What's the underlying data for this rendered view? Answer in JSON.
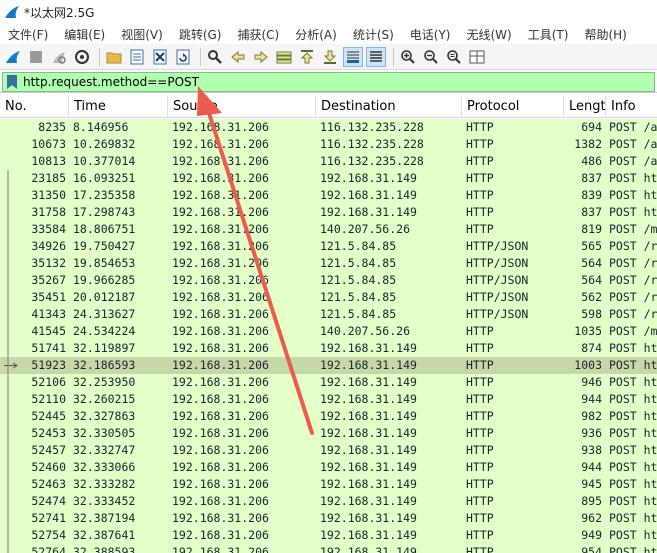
{
  "window": {
    "title": "*以太网2.5G"
  },
  "menu": [
    "文件(F)",
    "编辑(E)",
    "视图(V)",
    "跳转(G)",
    "捕获(C)",
    "分析(A)",
    "统计(S)",
    "电话(Y)",
    "无线(W)",
    "工具(T)",
    "帮助(H)"
  ],
  "filter": {
    "value": "http.request.method==POST"
  },
  "columns": [
    "No.",
    "Time",
    "Source",
    "Destination",
    "Protocol",
    "Lengt",
    "Info"
  ],
  "packets": [
    {
      "no": "8235",
      "time": "8.146956",
      "src": "192.168.31.206",
      "dst": "116.132.235.228",
      "proto": "HTTP",
      "len": "694",
      "info": "POST /a"
    },
    {
      "no": "10673",
      "time": "10.269832",
      "src": "192.168.31.206",
      "dst": "116.132.235.228",
      "proto": "HTTP",
      "len": "1382",
      "info": "POST /a"
    },
    {
      "no": "10813",
      "time": "10.377014",
      "src": "192.168.31.206",
      "dst": "116.132.235.228",
      "proto": "HTTP",
      "len": "486",
      "info": "POST /a"
    },
    {
      "no": "23185",
      "time": "16.093251",
      "src": "192.168.31.206",
      "dst": "192.168.31.149",
      "proto": "HTTP",
      "len": "837",
      "info": "POST ht"
    },
    {
      "no": "31350",
      "time": "17.235358",
      "src": "192.168.31.206",
      "dst": "192.168.31.149",
      "proto": "HTTP",
      "len": "839",
      "info": "POST ht"
    },
    {
      "no": "31758",
      "time": "17.298743",
      "src": "192.168.31.206",
      "dst": "192.168.31.149",
      "proto": "HTTP",
      "len": "837",
      "info": "POST ht"
    },
    {
      "no": "33584",
      "time": "18.806751",
      "src": "192.168.31.206",
      "dst": "140.207.56.26",
      "proto": "HTTP",
      "len": "819",
      "info": "POST /m"
    },
    {
      "no": "34926",
      "time": "19.750427",
      "src": "192.168.31.206",
      "dst": "121.5.84.85",
      "proto": "HTTP/JSON",
      "len": "565",
      "info": "POST /r"
    },
    {
      "no": "35132",
      "time": "19.854653",
      "src": "192.168.31.206",
      "dst": "121.5.84.85",
      "proto": "HTTP/JSON",
      "len": "564",
      "info": "POST /r"
    },
    {
      "no": "35267",
      "time": "19.966285",
      "src": "192.168.31.206",
      "dst": "121.5.84.85",
      "proto": "HTTP/JSON",
      "len": "564",
      "info": "POST /r"
    },
    {
      "no": "35451",
      "time": "20.012187",
      "src": "192.168.31.206",
      "dst": "121.5.84.85",
      "proto": "HTTP/JSON",
      "len": "562",
      "info": "POST /r"
    },
    {
      "no": "41343",
      "time": "24.313627",
      "src": "192.168.31.206",
      "dst": "121.5.84.85",
      "proto": "HTTP/JSON",
      "len": "598",
      "info": "POST /r"
    },
    {
      "no": "41545",
      "time": "24.534224",
      "src": "192.168.31.206",
      "dst": "140.207.56.26",
      "proto": "HTTP",
      "len": "1035",
      "info": "POST /m"
    },
    {
      "no": "51741",
      "time": "32.119897",
      "src": "192.168.31.206",
      "dst": "192.168.31.149",
      "proto": "HTTP",
      "len": "874",
      "info": "POST ht"
    },
    {
      "no": "51923",
      "time": "32.186593",
      "src": "192.168.31.206",
      "dst": "192.168.31.149",
      "proto": "HTTP",
      "len": "1003",
      "info": "POST ht",
      "selected": true
    },
    {
      "no": "52106",
      "time": "32.253950",
      "src": "192.168.31.206",
      "dst": "192.168.31.149",
      "proto": "HTTP",
      "len": "946",
      "info": "POST ht"
    },
    {
      "no": "52110",
      "time": "32.260215",
      "src": "192.168.31.206",
      "dst": "192.168.31.149",
      "proto": "HTTP",
      "len": "944",
      "info": "POST ht"
    },
    {
      "no": "52445",
      "time": "32.327863",
      "src": "192.168.31.206",
      "dst": "192.168.31.149",
      "proto": "HTTP",
      "len": "982",
      "info": "POST ht"
    },
    {
      "no": "52453",
      "time": "32.330505",
      "src": "192.168.31.206",
      "dst": "192.168.31.149",
      "proto": "HTTP",
      "len": "936",
      "info": "POST ht"
    },
    {
      "no": "52457",
      "time": "32.332747",
      "src": "192.168.31.206",
      "dst": "192.168.31.149",
      "proto": "HTTP",
      "len": "938",
      "info": "POST ht"
    },
    {
      "no": "52460",
      "time": "32.333066",
      "src": "192.168.31.206",
      "dst": "192.168.31.149",
      "proto": "HTTP",
      "len": "944",
      "info": "POST ht"
    },
    {
      "no": "52463",
      "time": "32.333282",
      "src": "192.168.31.206",
      "dst": "192.168.31.149",
      "proto": "HTTP",
      "len": "945",
      "info": "POST ht"
    },
    {
      "no": "52474",
      "time": "32.333452",
      "src": "192.168.31.206",
      "dst": "192.168.31.149",
      "proto": "HTTP",
      "len": "895",
      "info": "POST ht"
    },
    {
      "no": "52741",
      "time": "32.387194",
      "src": "192.168.31.206",
      "dst": "192.168.31.149",
      "proto": "HTTP",
      "len": "962",
      "info": "POST ht"
    },
    {
      "no": "52754",
      "time": "32.387641",
      "src": "192.168.31.206",
      "dst": "192.168.31.149",
      "proto": "HTTP",
      "len": "949",
      "info": "POST ht"
    },
    {
      "no": "52764",
      "time": "32.388593",
      "src": "192.168.31.206",
      "dst": "192.168.31.149",
      "proto": "HTTP",
      "len": "954",
      "info": "POST ht"
    }
  ],
  "colors": {
    "row_bg": "#e4ffc7",
    "selected_bg": "#c6d8a8",
    "filter_bg": "#afffaf",
    "annotation_arrow": "#ec5a50"
  }
}
